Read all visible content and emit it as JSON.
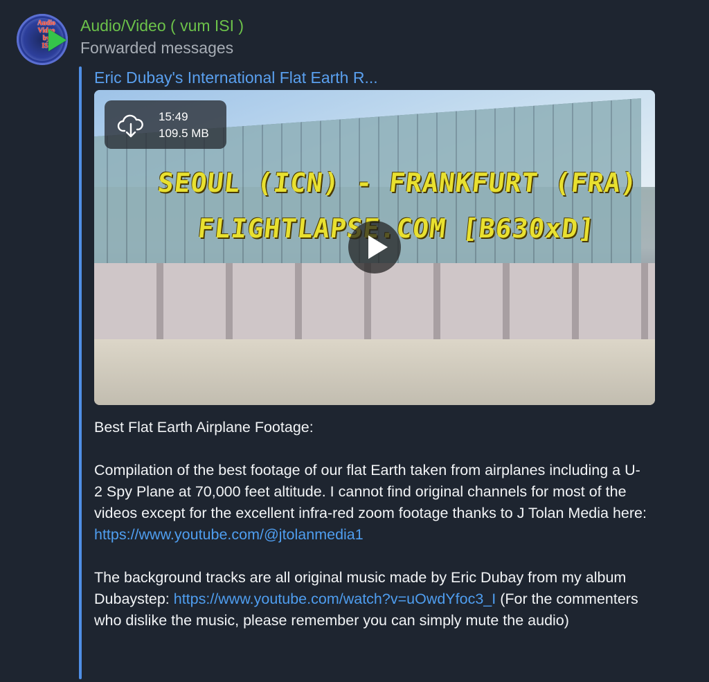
{
  "channel": {
    "name": "Audio/Video ( vum ISI )",
    "subtitle": "Forwarded messages",
    "avatar_text": [
      "Audio",
      "Video",
      "by",
      "ISI"
    ]
  },
  "message": {
    "forwarded_from": "Eric Dubay's International Flat Earth R...",
    "video": {
      "duration": "15:49",
      "file_size": "109.5 MB",
      "overlay_line1": "SEOUL (ICN) - FRANKFURT (FRA)",
      "overlay_line2": "FLIGHTLAPSE.COM  [B630xD]"
    },
    "caption": {
      "title": "Best Flat Earth Airplane Footage:",
      "p1_text": "Compilation of the best footage of our flat Earth taken from airplanes including a U-2 Spy Plane at 70,000 feet altitude.  I cannot find original channels for most of the videos except for the excellent infra-red zoom footage thanks to J Tolan Media  here:  ",
      "p1_link": "https://www.youtube.com/@jtolanmedia1",
      "p2_text": "The background tracks are all original music made by Eric Dubay from my album Dubaystep:  ",
      "p2_link": "https://www.youtube.com/watch?v=uOwdYfoc3_I",
      "p2_tail": "  (For the commenters who dislike the music, please remember you can simply mute the audio)"
    }
  },
  "colors": {
    "background": "#1e2530",
    "channel_name": "#6cc24a",
    "link": "#4f9ef0",
    "forward_bar": "#4f8fe6"
  }
}
